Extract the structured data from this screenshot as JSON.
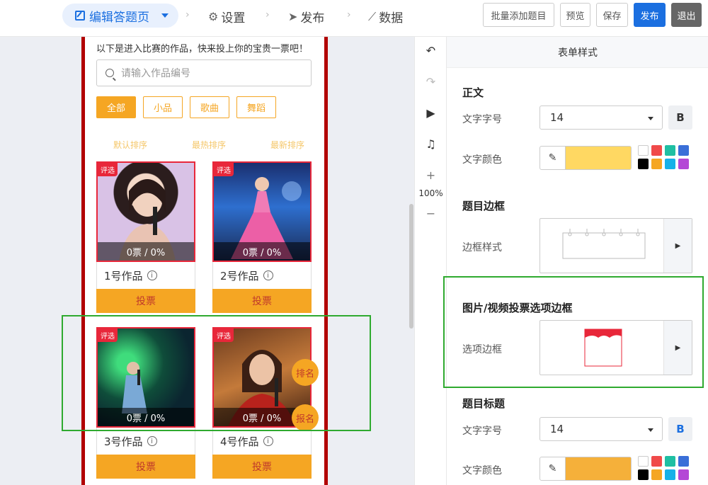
{
  "topbar": {
    "edit_label": "编辑答题页",
    "settings_label": "设置",
    "publish_nav_label": "发布",
    "data_label": "数据",
    "batch_add_label": "批量添加题目",
    "preview_label": "预览",
    "save_label": "保存",
    "publish_label": "发布",
    "exit_label": "退出"
  },
  "phone": {
    "intro": "以下是进入比赛的作品，快来投上你的宝贵一票吧！",
    "search_placeholder": "请输入作品编号",
    "filters": [
      "全部",
      "小品",
      "歌曲",
      "舞蹈"
    ],
    "sorts": [
      "默认排序",
      "最热排序",
      "最新排序"
    ],
    "cards": [
      {
        "tag": "评选",
        "votes": "0票 / 0%",
        "name": "1号作品",
        "vote": "投票"
      },
      {
        "tag": "评选",
        "votes": "0票 / 0%",
        "name": "2号作品",
        "vote": "投票"
      },
      {
        "tag": "评选",
        "votes": "0票 / 0%",
        "name": "3号作品",
        "vote": "投票"
      },
      {
        "tag": "评选",
        "votes": "0票 / 0%",
        "name": "4号作品",
        "vote": "投票"
      }
    ],
    "rank_label": "排名",
    "signup_label": "报名"
  },
  "tools": {
    "zoom": "100%"
  },
  "panel": {
    "title": "表单样式",
    "body_section": "正文",
    "font_size_label": "文字字号",
    "font_size_value": "14",
    "bold_label": "B",
    "font_color_label": "文字颜色",
    "font_color": "#FFD862",
    "question_border_section": "题目边框",
    "border_style_label": "边框样式",
    "option_border_section": "图片/视频投票选项边框",
    "option_border_label": "选项边框",
    "question_title_section": "题目标题",
    "title_font_size_label": "文字字号",
    "title_font_size_value": "14",
    "title_bold_label": "B",
    "title_font_color_label": "文字颜色",
    "title_font_color": "#F5B03A",
    "palette": [
      "#ffffff",
      "#f04a4a",
      "#1fbfa3",
      "#3a6fd8",
      "#000000",
      "#f5a623",
      "#16b1e8",
      "#b447d6"
    ]
  }
}
